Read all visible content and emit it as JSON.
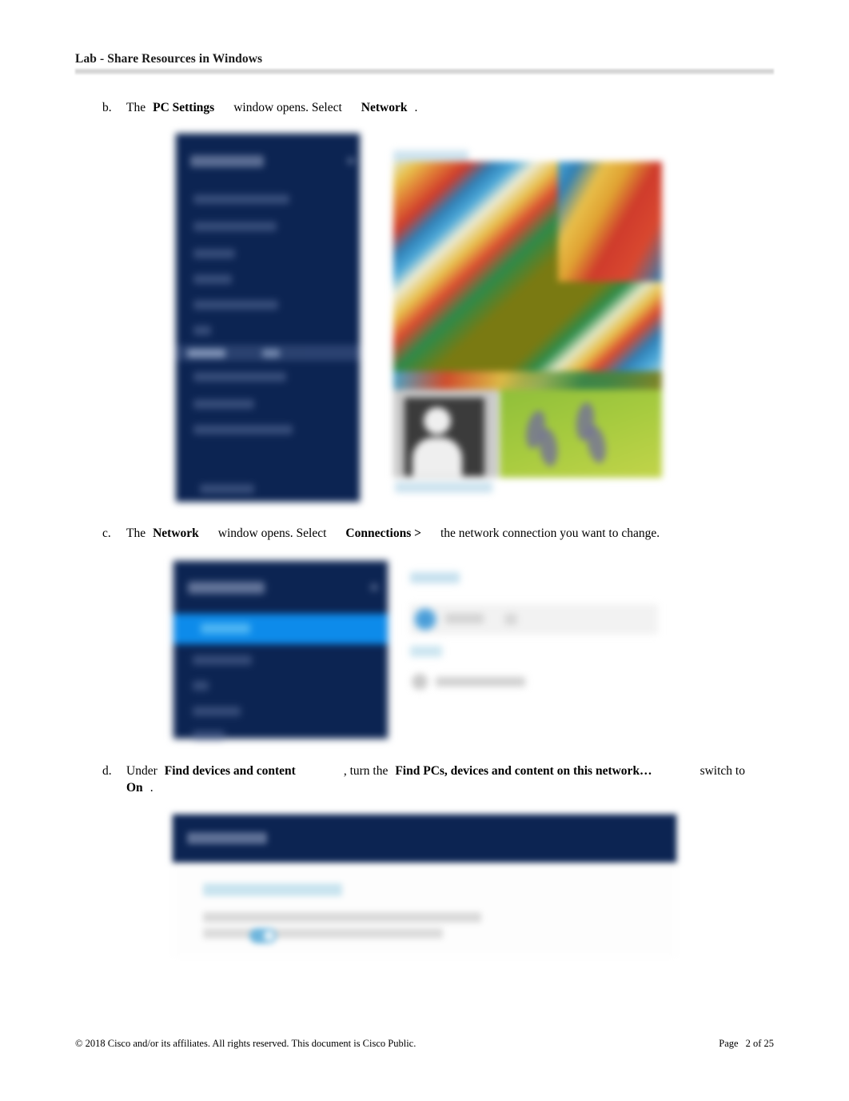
{
  "document": {
    "header_title": "Lab - Share Resources in Windows",
    "footer_copyright": "© 2018 Cisco and/or its affiliates. All rights reserved. This document is Cisco Public.",
    "footer_page_label": "Page",
    "footer_page_number": "2",
    "footer_page_of": "of 25"
  },
  "steps": {
    "b": {
      "marker": "b.",
      "text_1": "The",
      "bold_1": "PC Settings",
      "text_2": "window opens. Select",
      "bold_2": "Network",
      "text_3": "."
    },
    "c": {
      "marker": "c.",
      "text_1": "The",
      "bold_1": "Network",
      "text_2": "window opens. Select",
      "bold_2": "Connections >",
      "text_3": "the network connection you want to change."
    },
    "d": {
      "marker": "d.",
      "text_1": "Under",
      "bold_1": "Find devices and content",
      "text_2": ", turn the",
      "bold_2": "Find PCs, devices and content on this network…",
      "text_3": "switch to",
      "bold_3": "On",
      "text_4": "."
    }
  },
  "figures": {
    "pc_settings": {
      "caption": "blurred screenshot of PC Settings window",
      "sidebar_color": "#0c2452",
      "sidebar_item_count": 10,
      "tile_heading_color": "#cde3ef"
    },
    "network": {
      "caption": "blurred screenshot of Network settings window",
      "sidebar_color": "#0c2452",
      "highlight_color": "#0d8bea",
      "highlighted_item": "Connections",
      "panel_icon": "wifi-icon"
    },
    "find_devices": {
      "caption": "blurred screenshot of Find devices and content setting",
      "bar_color": "#0c2452",
      "toggle_color": "#6fb6dd",
      "toggle_state": "On"
    }
  }
}
